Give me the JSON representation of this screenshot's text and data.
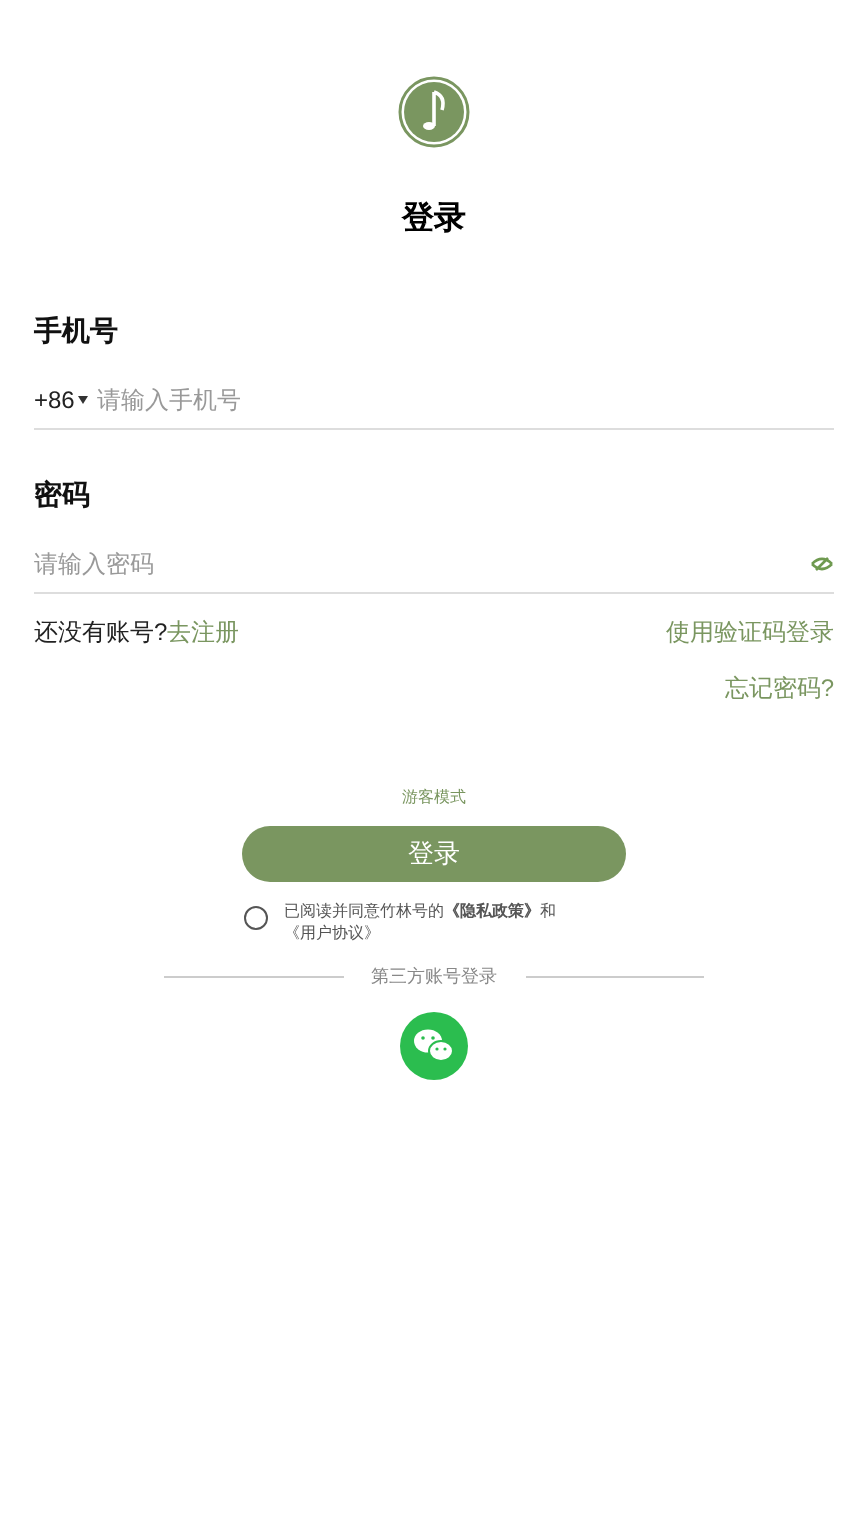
{
  "title": "登录",
  "phone": {
    "label": "手机号",
    "country_code": "+86",
    "placeholder": "请输入手机号"
  },
  "password": {
    "label": "密码",
    "placeholder": "请输入密码"
  },
  "register": {
    "prompt": "还没有账号?",
    "link": "去注册"
  },
  "code_login": "使用验证码登录",
  "forgot": "忘记密码?",
  "guest": "游客模式",
  "login_button": "登录",
  "agreement": {
    "checked": false,
    "text": "已阅读并同意竹林号的**《隐私政策》**和《用户协议》"
  },
  "third_party": {
    "label": "第三方账号登录"
  }
}
